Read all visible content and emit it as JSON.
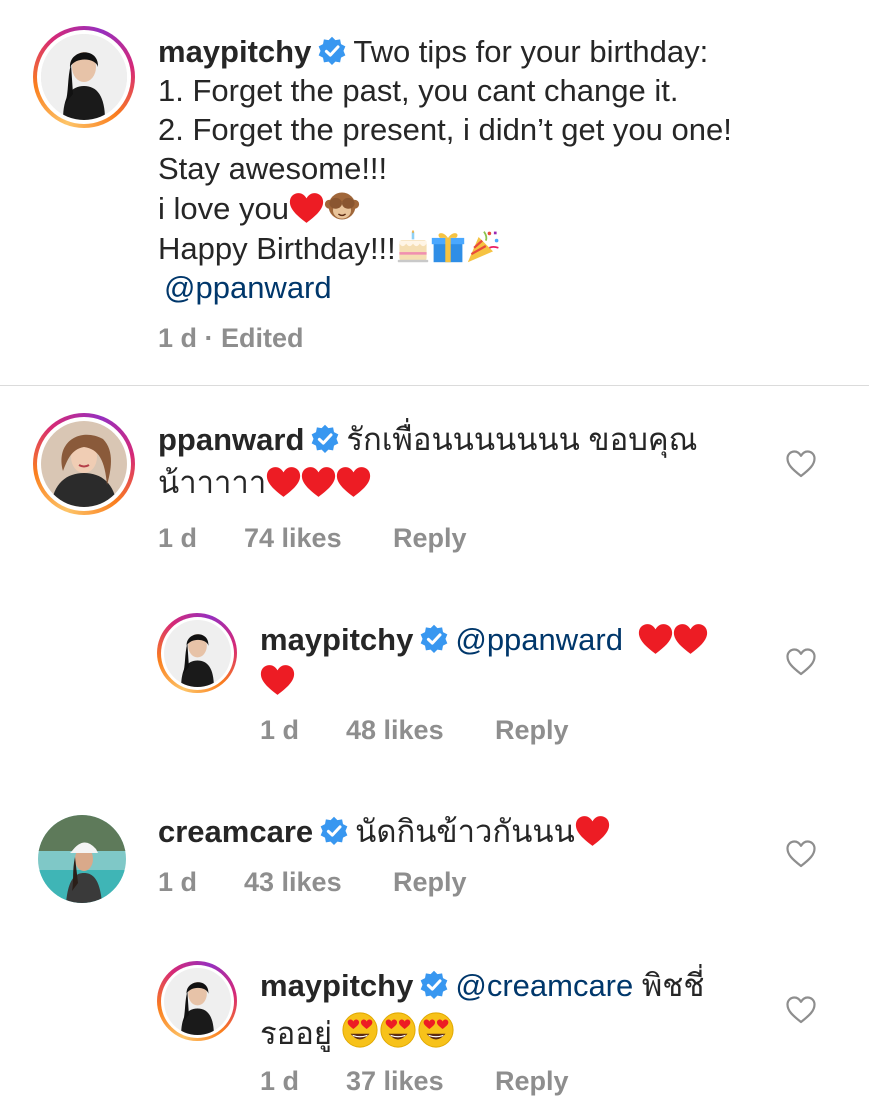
{
  "caption": {
    "username": "maypitchy",
    "lines": [
      "Two tips for your birthday:",
      "1. Forget the past, you cant change it.",
      "2. Forget the present, i didn’t  get you one!",
      "Stay awesome!!!",
      "i love you",
      "Happy Birthday!!!",
      "@ppanward"
    ],
    "meta": "1 d · Edited"
  },
  "comments": [
    {
      "username": "ppanward",
      "text_line1": "รักเพื่อนนนนนนน ขอบคุณ",
      "text_line2": "น้าาาาา",
      "time": "1 d",
      "likes": "74 likes",
      "reply": "Reply"
    },
    {
      "username": "maypitchy",
      "mention": "@ppanward",
      "time": "1 d",
      "likes": "48 likes",
      "reply": "Reply"
    },
    {
      "username": "creamcare",
      "text_line1": "นัดกินข้าวกันนน",
      "time": "1 d",
      "likes": "43 likes",
      "reply": "Reply"
    },
    {
      "username": "maypitchy",
      "mention": "@creamcare",
      "text_line1": "พิชชี่",
      "text_line2": "รออยู่",
      "time": "1 d",
      "likes": "37 likes",
      "reply": "Reply"
    }
  ],
  "colors": {
    "text": "#262626",
    "secondary": "#8e8e8e",
    "mention": "#00376b",
    "verified": "#3897f0",
    "heart": "#ed1c24"
  },
  "icons": {
    "verified": "verified-badge-icon",
    "like": "heart-outline-icon",
    "heart_emoji": "red-heart-emoji",
    "monkey": "see-no-evil-monkey-emoji",
    "cake": "birthday-cake-emoji",
    "gift": "gift-emoji",
    "party": "party-popper-emoji",
    "heart_eyes": "heart-eyes-emoji"
  }
}
